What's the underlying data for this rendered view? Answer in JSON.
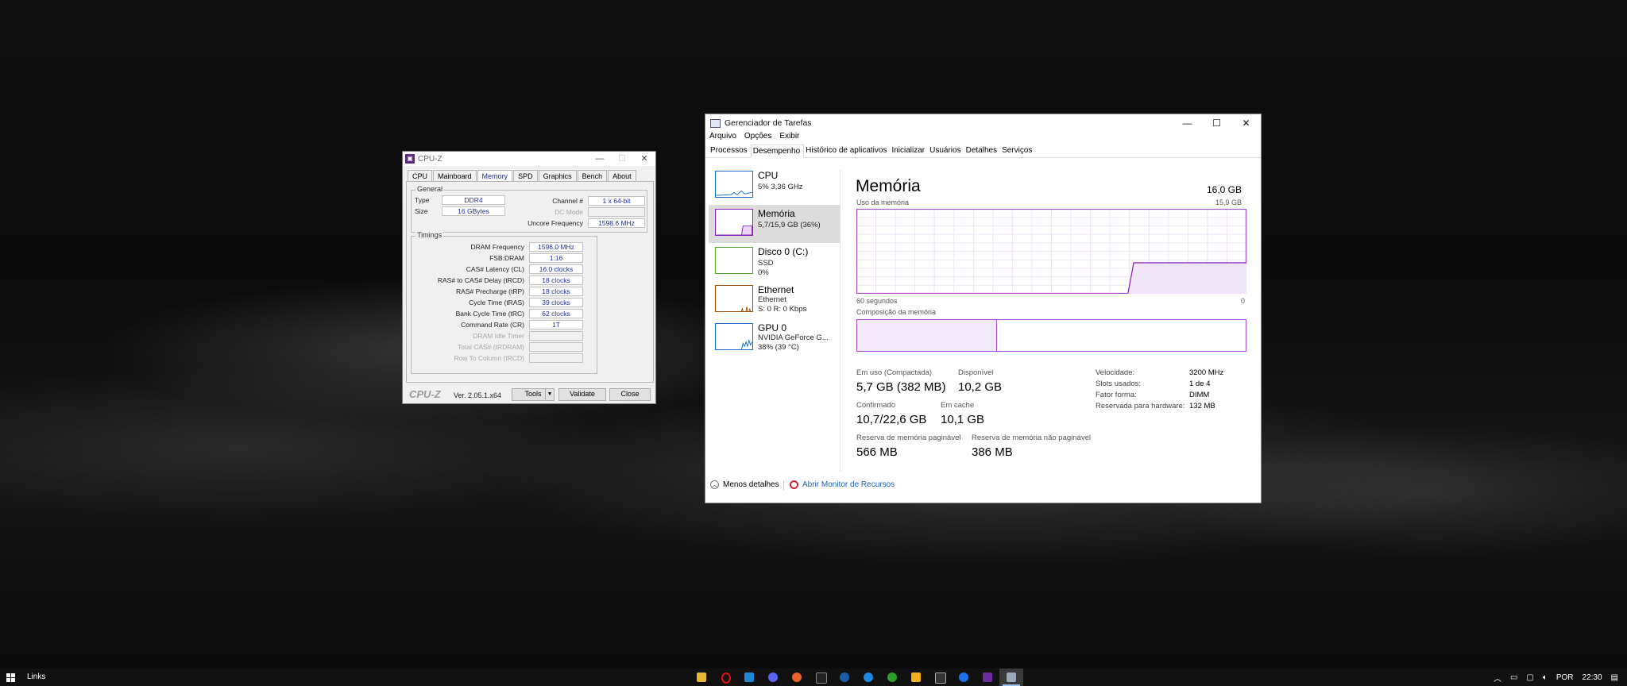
{
  "cpuz": {
    "title": "CPU-Z",
    "tabs": [
      "CPU",
      "Mainboard",
      "Memory",
      "SPD",
      "Graphics",
      "Bench",
      "About"
    ],
    "active_tab": "Memory",
    "general": {
      "label": "General",
      "type_label": "Type",
      "type_value": "DDR4",
      "size_label": "Size",
      "size_value": "16 GBytes",
      "channel_label": "Channel #",
      "channel_value": "1 x 64-bit",
      "dc_mode_label": "DC Mode",
      "dc_mode_value": "",
      "uncore_label": "Uncore Frequency",
      "uncore_value": "1598.6 MHz"
    },
    "timings": {
      "label": "Timings",
      "rows": [
        {
          "label": "DRAM Frequency",
          "value": "1596.0 MHz"
        },
        {
          "label": "FSB:DRAM",
          "value": "1:16"
        },
        {
          "label": "CAS# Latency (CL)",
          "value": "16.0 clocks"
        },
        {
          "label": "RAS# to CAS# Delay (tRCD)",
          "value": "18 clocks"
        },
        {
          "label": "RAS# Precharge (tRP)",
          "value": "18 clocks"
        },
        {
          "label": "Cycle Time (tRAS)",
          "value": "39 clocks"
        },
        {
          "label": "Bank Cycle Time (tRC)",
          "value": "62 clocks"
        },
        {
          "label": "Command Rate (CR)",
          "value": "1T"
        },
        {
          "label": "DRAM Idle Timer",
          "value": ""
        },
        {
          "label": "Total CAS# (tRDRAM)",
          "value": ""
        },
        {
          "label": "Row To Column (tRCD)",
          "value": ""
        }
      ]
    },
    "brand": "CPU-Z",
    "version": "Ver. 2.05.1.x64",
    "tools_label": "Tools",
    "validate_label": "Validate",
    "close_label": "Close"
  },
  "taskmgr": {
    "title": "Gerenciador de Tarefas",
    "menu": [
      "Arquivo",
      "Opções",
      "Exibir"
    ],
    "tabs": [
      "Processos",
      "Desempenho",
      "Histórico de aplicativos",
      "Inicializar",
      "Usuários",
      "Detalhes",
      "Serviços"
    ],
    "active_tab": "Desempenho",
    "sidebar": [
      {
        "name": "CPU",
        "line1": "5% 3,36 GHz",
        "line2": "",
        "color": "#1170cf"
      },
      {
        "name": "Memória",
        "line1": "5,7/15,9 GB (36%)",
        "line2": "",
        "color": "#8b1dbd"
      },
      {
        "name": "Disco 0 (C:)",
        "line1": "SSD",
        "line2": "0%",
        "color": "#4da81f"
      },
      {
        "name": "Ethernet",
        "line1": "Ethernet",
        "line2": "S: 0 R: 0 Kbps",
        "color": "#a74f01"
      },
      {
        "name": "GPU 0",
        "line1": "NVIDIA GeForce G...",
        "line2": "38% (39 °C)",
        "color": "#1170cf"
      }
    ],
    "memory": {
      "title": "Memória",
      "total": "16,0 GB",
      "usage_label": "Uso da memória",
      "usage_max": "15,9 GB",
      "time_left": "60 segundos",
      "time_right": "0",
      "composition_label": "Composição da memória",
      "in_use_fraction": 0.36,
      "in_use_label": "Em uso (Compactada)",
      "in_use_value": "5,7 GB (382 MB)",
      "available_label": "Disponível",
      "available_value": "10,2 GB",
      "committed_label": "Confirmado",
      "committed_value": "10,7/22,6 GB",
      "cached_label": "Em cache",
      "cached_value": "10,1 GB",
      "paged_label": "Reserva de memória paginável",
      "paged_value": "566 MB",
      "nonpaged_label": "Reserva de memória não paginável",
      "nonpaged_value": "386 MB",
      "speed_label": "Velocidade:",
      "speed_value": "3200 MHz",
      "slots_label": "Slots usados:",
      "slots_value": "1 de 4",
      "form_label": "Fator forma:",
      "form_value": "DIMM",
      "reserved_label": "Reservada para hardware:",
      "reserved_value": "132 MB"
    },
    "fewer_details": "Menos detalhes",
    "open_resmon": "Abrir Monitor de Recursos"
  },
  "taskbar": {
    "links_label": "Links",
    "language": "POR",
    "time": "22:30"
  }
}
